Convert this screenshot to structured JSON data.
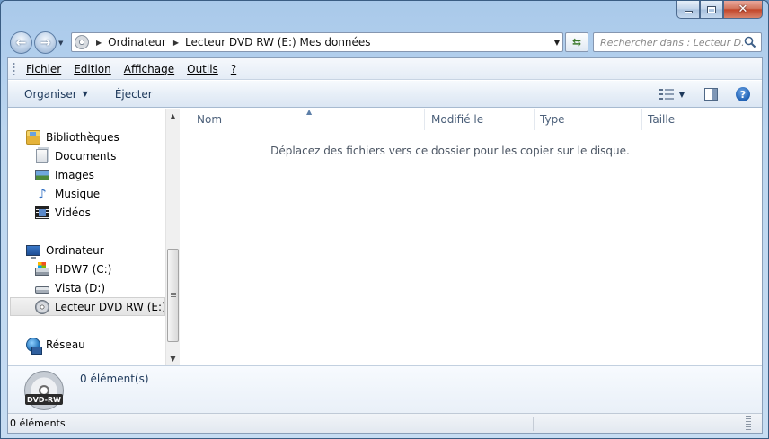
{
  "address": {
    "crumb_1": "Ordinateur",
    "crumb_2": "Lecteur DVD RW (E:) Mes données"
  },
  "search": {
    "placeholder": "Rechercher dans : Lecteur D..."
  },
  "menu": {
    "file": "Fichier",
    "edit": "Edition",
    "view": "Affichage",
    "tools": "Outils",
    "help": "?"
  },
  "toolbar": {
    "organize": "Organiser",
    "eject": "Éjecter"
  },
  "navpane": {
    "libraries": "Bibliothèques",
    "documents": "Documents",
    "images": "Images",
    "music": "Musique",
    "videos": "Vidéos",
    "computer": "Ordinateur",
    "drive_c": "HDW7 (C:)",
    "drive_d": "Vista (D:)",
    "drive_e": "Lecteur DVD RW (E:) Mes données",
    "network": "Réseau"
  },
  "columns": {
    "name": "Nom",
    "modified": "Modifié le",
    "type": "Type",
    "size": "Taille"
  },
  "content": {
    "empty_message": "Déplacez des fichiers vers ce dossier pour les copier sur le disque."
  },
  "details": {
    "badge": "DVD-RW",
    "count": "0 élément(s)"
  },
  "statusbar": {
    "count": "0 éléments"
  }
}
